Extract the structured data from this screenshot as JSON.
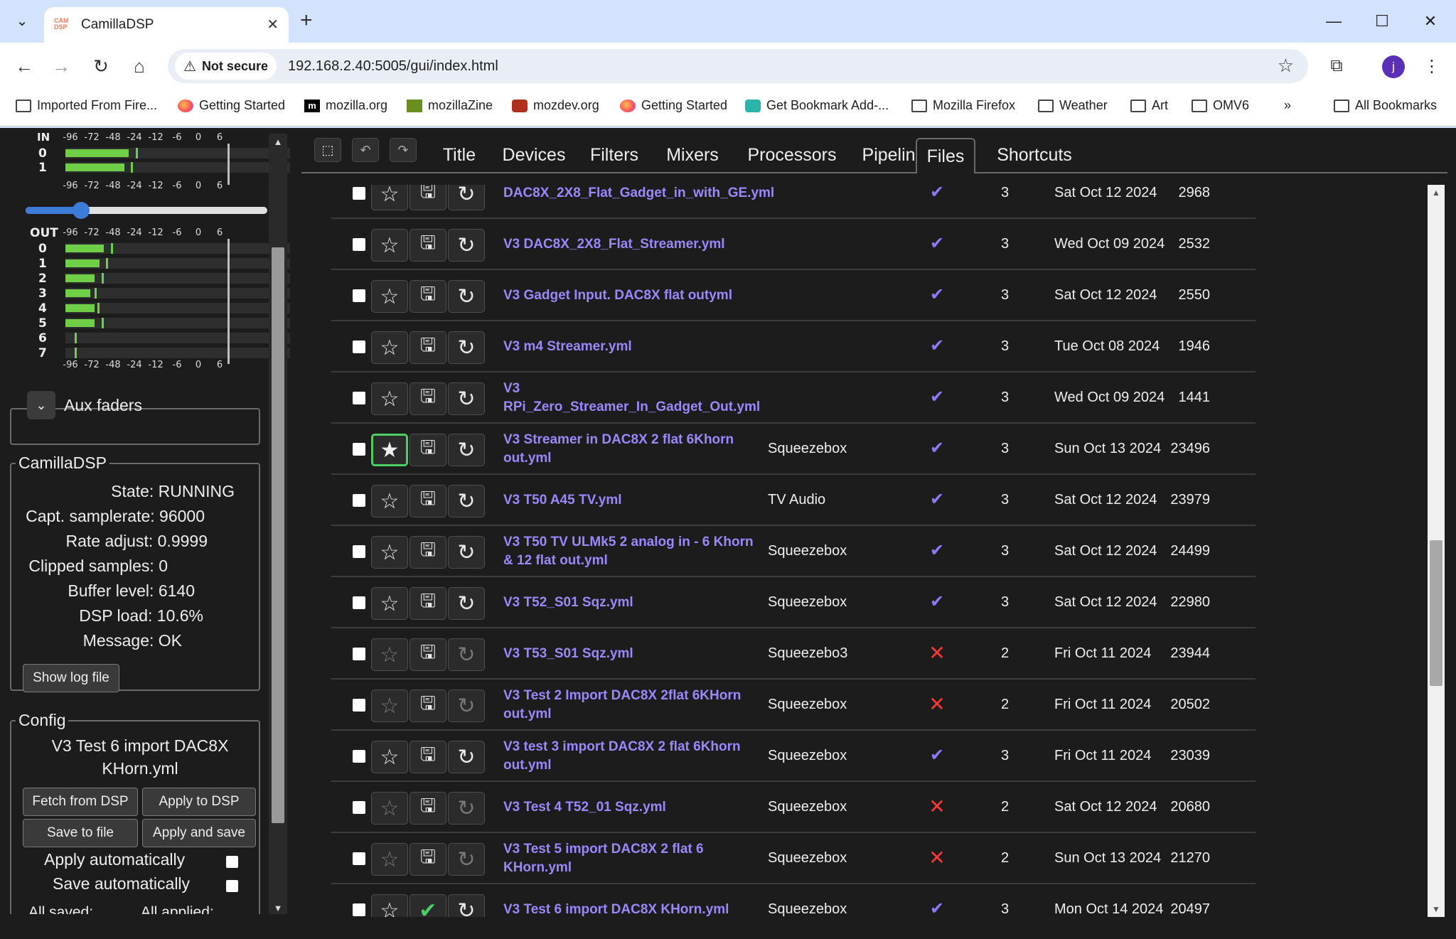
{
  "browser": {
    "tab_title": "CamillaDSP",
    "tab_favicon_text": "CAM DSP",
    "security_label": "Not secure",
    "url": "192.168.2.40:5005/gui/index.html",
    "avatar_letter": "j",
    "bookmarks": [
      {
        "label": "Imported From Fire...",
        "icon": "folder-icon"
      },
      {
        "label": "Getting Started",
        "icon": "firefox-icon"
      },
      {
        "label": "mozilla.org",
        "icon": "mozilla-icon"
      },
      {
        "label": "mozillaZine",
        "icon": "mozillazine-icon"
      },
      {
        "label": "mozdev.org",
        "icon": "mozdev-icon"
      },
      {
        "label": "Getting Started",
        "icon": "firefox-icon"
      },
      {
        "label": "Get Bookmark Add-...",
        "icon": "puzzle-icon"
      },
      {
        "label": "Mozilla Firefox",
        "icon": "folder-icon"
      },
      {
        "label": "Weather",
        "icon": "folder-icon"
      },
      {
        "label": "Art",
        "icon": "folder-icon"
      },
      {
        "label": "OMV6",
        "icon": "folder-icon"
      }
    ],
    "bookmarks_overflow": "»",
    "all_bookmarks": "All Bookmarks"
  },
  "meters": {
    "in_label": "IN",
    "out_label": "OUT",
    "scale": [
      "-96",
      "-72",
      "-48",
      "-24",
      "-12",
      "-6",
      "0",
      "6"
    ],
    "in_channels": [
      {
        "label": "0",
        "level": 0.28,
        "peak": 0.31
      },
      {
        "label": "1",
        "level": 0.26,
        "peak": 0.29
      }
    ],
    "out_channels": [
      {
        "label": "0",
        "level": 0.17,
        "peak": 0.2
      },
      {
        "label": "1",
        "level": 0.15,
        "peak": 0.18
      },
      {
        "label": "2",
        "level": 0.13,
        "peak": 0.16
      },
      {
        "label": "3",
        "level": 0.11,
        "peak": 0.13
      },
      {
        "label": "4",
        "level": 0.13,
        "peak": 0.14
      },
      {
        "label": "5",
        "level": 0.13,
        "peak": 0.16
      },
      {
        "label": "6",
        "level": 0.0,
        "peak": 0.04
      },
      {
        "label": "7",
        "level": 0.0,
        "peak": 0.04
      }
    ],
    "volume_fraction": 0.23
  },
  "aux": {
    "label": "Aux faders"
  },
  "camilladsp": {
    "legend": "CamillaDSP",
    "state": "State: RUNNING",
    "samplerate": "Capt. samplerate: 96000",
    "rate_adjust": "Rate adjust: 0.9999",
    "clipped": "Clipped samples: 0",
    "buffer": "Buffer level: 6140",
    "load": "DSP load: 10.6%",
    "message": "Message: OK",
    "show_log": "Show log file"
  },
  "config": {
    "legend": "Config",
    "name_line1": "V3 Test 6 import DAC8X",
    "name_line2": "KHorn.yml",
    "fetch": "Fetch from DSP",
    "apply": "Apply to DSP",
    "save": "Save to file",
    "apply_save": "Apply and save",
    "apply_auto": "Apply automatically",
    "save_auto": "Save automatically",
    "all_saved": "All saved:",
    "all_applied": "All applied:"
  },
  "nav": {
    "tabs": [
      "Title",
      "Devices",
      "Filters",
      "Mixers",
      "Processors",
      "Pipeline",
      "Files",
      "Shortcuts"
    ],
    "active": "Files"
  },
  "files": [
    {
      "name": "DAC8X_2X8_Flat_Gadget_in_with_GE.yml",
      "title": "",
      "valid": true,
      "version": "3",
      "date": "Sat Oct 12 2024",
      "size": "2968",
      "favorite": false,
      "enabled": true
    },
    {
      "name": "V3 DAC8X_2X8_Flat_Streamer.yml",
      "title": "",
      "valid": true,
      "version": "3",
      "date": "Wed Oct 09 2024",
      "size": "2532",
      "favorite": false,
      "enabled": true
    },
    {
      "name": "V3 Gadget Input. DAC8X flat outyml",
      "title": "",
      "valid": true,
      "version": "3",
      "date": "Sat Oct 12 2024",
      "size": "2550",
      "favorite": false,
      "enabled": true
    },
    {
      "name": "V3 m4 Streamer.yml",
      "title": "",
      "valid": true,
      "version": "3",
      "date": "Tue Oct 08 2024",
      "size": "1946",
      "favorite": false,
      "enabled": true
    },
    {
      "name": "V3 RPi_Zero_Streamer_In_Gadget_Out.yml",
      "title": "",
      "valid": true,
      "version": "3",
      "date": "Wed Oct 09 2024",
      "size": "1441",
      "favorite": false,
      "enabled": true
    },
    {
      "name": "V3 Streamer in DAC8X 2 flat 6Khorn out.yml",
      "title": "Squeezebox",
      "valid": true,
      "version": "3",
      "date": "Sun Oct 13 2024",
      "size": "23496",
      "favorite": true,
      "enabled": true
    },
    {
      "name": "V3 T50 A45 TV.yml",
      "title": "TV Audio",
      "valid": true,
      "version": "3",
      "date": "Sat Oct 12 2024",
      "size": "23979",
      "favorite": false,
      "enabled": true
    },
    {
      "name": "V3 T50 TV ULMk5 2 analog in - 6 Khorn & 12 flat out.yml",
      "title": "Squeezebox",
      "valid": true,
      "version": "3",
      "date": "Sat Oct 12 2024",
      "size": "24499",
      "favorite": false,
      "enabled": true
    },
    {
      "name": "V3 T52_S01 Sqz.yml",
      "title": "Squeezebox",
      "valid": true,
      "version": "3",
      "date": "Sat Oct 12 2024",
      "size": "22980",
      "favorite": false,
      "enabled": true
    },
    {
      "name": "V3 T53_S01 Sqz.yml",
      "title": "Squeezebo3",
      "valid": false,
      "version": "2",
      "date": "Fri Oct 11 2024",
      "size": "23944",
      "favorite": false,
      "enabled": false
    },
    {
      "name": "V3 Test 2 Import DAC8X 2flat 6KHorn out.yml",
      "title": "Squeezebox",
      "valid": false,
      "version": "2",
      "date": "Fri Oct 11 2024",
      "size": "20502",
      "favorite": false,
      "enabled": false
    },
    {
      "name": "V3 test 3 import DAC8X 2 flat 6Khorn out.yml",
      "title": "Squeezebox",
      "valid": true,
      "version": "3",
      "date": "Fri Oct 11 2024",
      "size": "23039",
      "favorite": false,
      "enabled": true
    },
    {
      "name": "V3 Test 4 T52_01 Sqz.yml",
      "title": "Squeezebox",
      "valid": false,
      "version": "2",
      "date": "Sat Oct 12 2024",
      "size": "20680",
      "favorite": false,
      "enabled": false
    },
    {
      "name": "V3 Test 5 import DAC8X 2 flat 6 KHorn.yml",
      "title": "Squeezebox",
      "valid": false,
      "version": "2",
      "date": "Sun Oct 13 2024",
      "size": "21270",
      "favorite": false,
      "enabled": false
    },
    {
      "name": "V3 Test 6 import DAC8X KHorn.yml",
      "title": "Squeezebox",
      "valid": true,
      "version": "3",
      "date": "Mon Oct 14 2024",
      "size": "20497",
      "favorite": false,
      "enabled": true,
      "current": true
    }
  ],
  "colors": {
    "accent": "#3d7bd9",
    "meter_green": "#6fcf47",
    "link": "#9a88ff",
    "valid_check": "#8a7cff",
    "invalid_x": "#ff3838",
    "favorite_border": "#4ccf62"
  }
}
